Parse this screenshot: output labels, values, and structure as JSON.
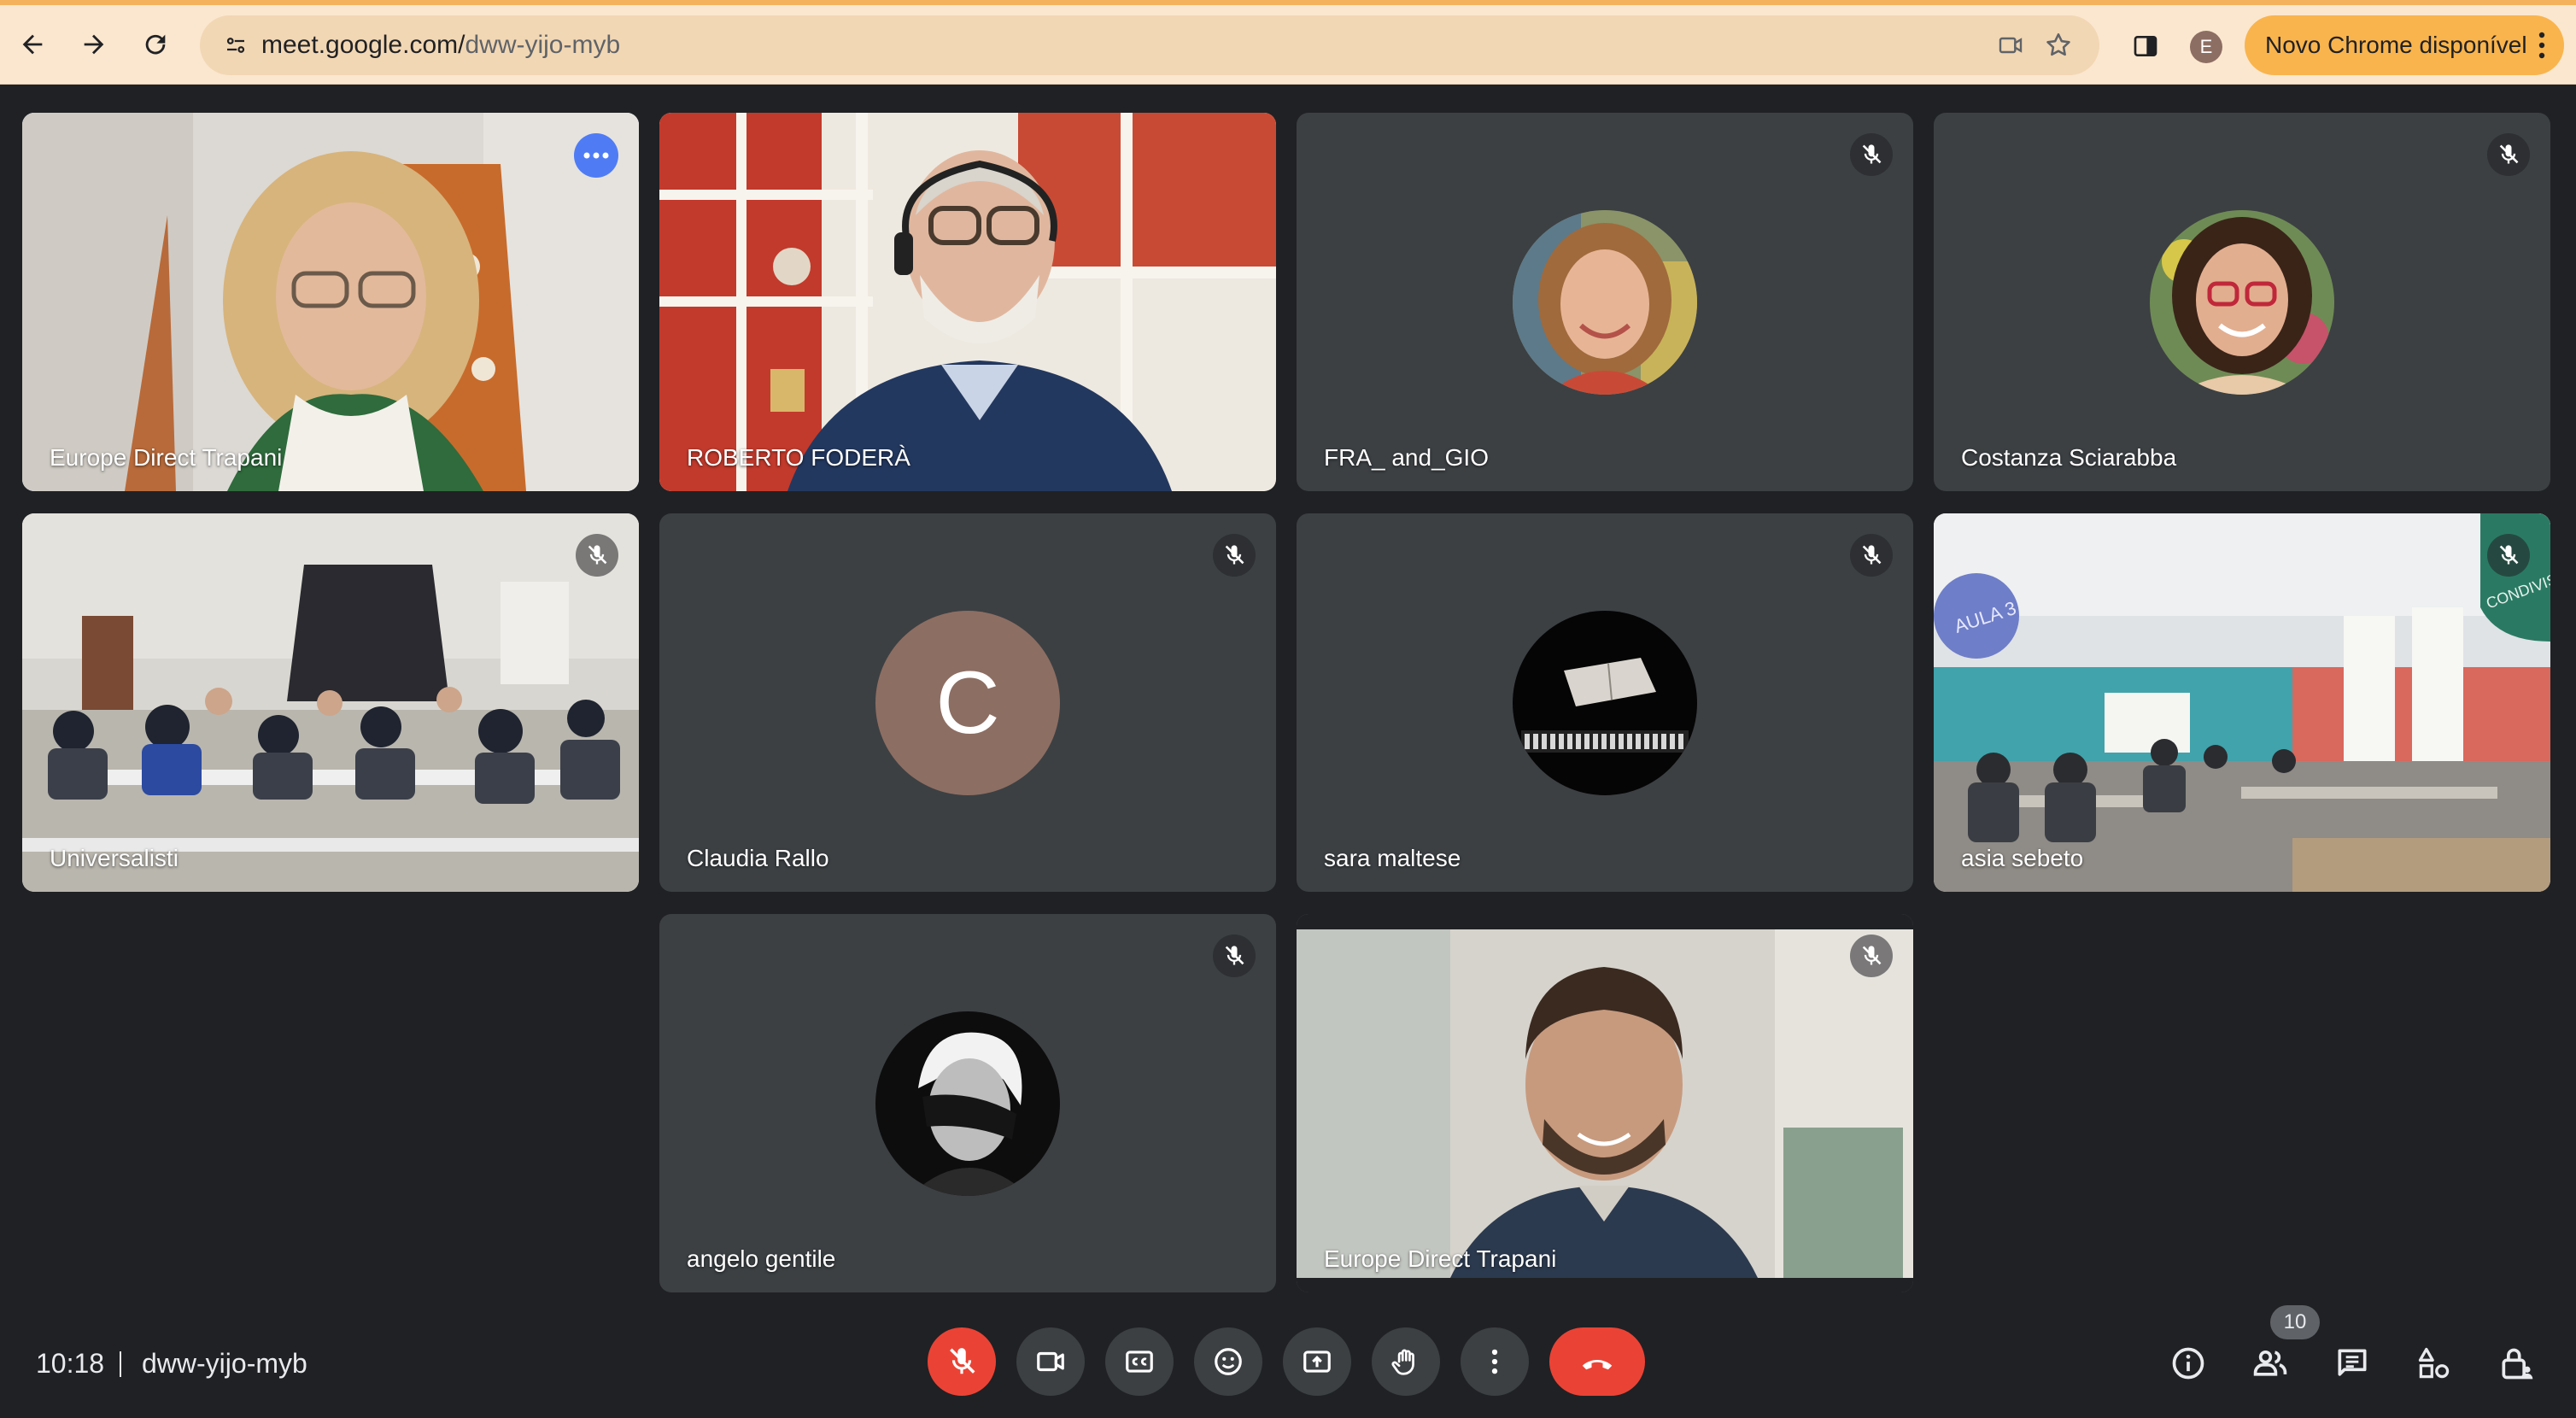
{
  "browser": {
    "url_host": "meet.google.com/",
    "url_path": "dww-yijo-myb",
    "profile_initial": "E",
    "update_label": "Novo Chrome disponível"
  },
  "participants": [
    {
      "name": "Europe Direct Trapani",
      "type": "video",
      "muted": false,
      "active": true
    },
    {
      "name": "ROBERTO FODERÀ",
      "type": "video",
      "muted": false
    },
    {
      "name": "FRA_ and_GIO",
      "type": "avatar",
      "muted": true
    },
    {
      "name": "Costanza Sciarabba",
      "type": "avatar",
      "muted": true
    },
    {
      "name": "Universalisti",
      "type": "video",
      "muted": true
    },
    {
      "name": "Claudia Rallo",
      "type": "letter",
      "initial": "C",
      "muted": true
    },
    {
      "name": "sara maltese",
      "type": "avatar",
      "muted": true
    },
    {
      "name": "asia sebeto",
      "type": "video",
      "muted": true
    },
    {
      "name": "angelo gentile",
      "type": "avatar",
      "muted": true
    },
    {
      "name": "Europe Direct Trapani",
      "type": "video",
      "muted": true
    }
  ],
  "room_signs": {
    "aula": "AULA 3",
    "banner": "CONDIVISI"
  },
  "bottom_bar": {
    "time": "10:18",
    "meeting_code": "dww-yijo-myb",
    "participant_count": "10"
  },
  "colors": {
    "background": "#202124",
    "tile": "#3c4043",
    "accent_blue": "#8ab4f8",
    "mic_off_red": "#ea4335",
    "chrome_update": "#f9b44d"
  }
}
